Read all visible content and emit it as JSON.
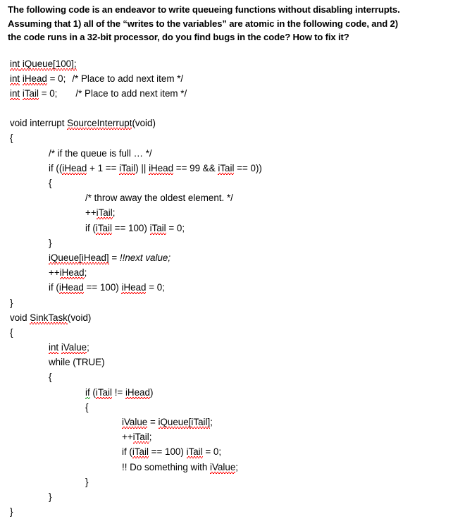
{
  "document": {
    "background_color": "#ffffff",
    "text_color": "#000000",
    "spellcheck_underline_color": "#ff0000",
    "grammarcheck_underline_color": "#2ca02c"
  },
  "prompt": {
    "line1": "The following code is an endeavor to write queueing functions without disabling interrupts.",
    "line2": "Assuming that 1) all of the “writes to the variables” are atomic in the following code, and 2)",
    "line3": "the code runs in a 32-bit processor, do you find bugs in the code? How to fix it?"
  },
  "code": {
    "declarations": {
      "queue_decl_kw": "int",
      "queue_decl_rest": " iQueue[100];",
      "head_decl_kw": "int",
      "head_decl_name": "iHead",
      "head_decl_rest": " = 0;",
      "head_decl_comment": "/* Place to add next item */",
      "tail_decl_kw": "int",
      "tail_decl_name": "iTail",
      "tail_decl_rest": " = 0;",
      "tail_decl_comment": "/* Place to add next item */"
    },
    "source_interrupt": {
      "signature_prefix": "void interrupt ",
      "signature_name": "SourceInterrupt",
      "signature_suffix": "(void)",
      "open_brace": "{",
      "comment_full": "/* if the queue is full … */",
      "if_full_a": "if ((",
      "if_full_head1": "iHead",
      "if_full_b": " + 1 == ",
      "if_full_tail1": "iTail",
      "if_full_c": ") || ",
      "if_full_head2": "iHead",
      "if_full_d": " == 99 && ",
      "if_full_tail2": "iTail",
      "if_full_e": " == 0))",
      "inner_open_brace": "{",
      "comment_throw": "/* throw away the oldest element. */",
      "inc_tail_prefix": "++",
      "inc_tail_name": "iTail",
      "inc_tail_suffix": ";",
      "wrap_tail_a": "if (",
      "wrap_tail_name1": "iTail",
      "wrap_tail_b": " == 100) ",
      "wrap_tail_name2": "iTail",
      "wrap_tail_c": " = 0;",
      "inner_close_brace": "}",
      "store_name": "iQueue[iHead]",
      "store_mid": " = ",
      "store_value": "!!next value;",
      "inc_head_prefix": "++",
      "inc_head_name": "iHead",
      "inc_head_suffix": ";",
      "wrap_head_a": "if (",
      "wrap_head_name1": "iHead",
      "wrap_head_b": " == 100) ",
      "wrap_head_name2": "iHead",
      "wrap_head_c": " = 0;",
      "close_brace": "}"
    },
    "sink_task": {
      "signature_prefix": "void ",
      "signature_name": "SinkTask",
      "signature_suffix": "(void)",
      "open_brace": "{",
      "value_decl_kw": "int",
      "value_decl_name": "iValue",
      "value_decl_suffix": ";",
      "while_line": "while (TRUE)",
      "while_open_brace": "{",
      "if_kw": "if",
      "if_a": " (",
      "if_tail": "iTail",
      "if_b": " != ",
      "if_head": "iHead",
      "if_c": ")",
      "if_open_brace": "{",
      "read_name": "iValue",
      "read_mid": " = ",
      "read_src": "iQueue[iTail]",
      "read_suffix": ";",
      "inc_tail_prefix": "++",
      "inc_tail_name": "iTail",
      "inc_tail_suffix": ";",
      "wrap_tail_a": "if (",
      "wrap_tail_name1": "iTail",
      "wrap_tail_b": " == 100) ",
      "wrap_tail_name2": "iTail",
      "wrap_tail_c": " = 0;",
      "do_something_prefix": "!! Do something with ",
      "do_something_name": "iValue",
      "do_something_suffix": ";",
      "if_close_brace": "}",
      "while_close_brace": "}",
      "close_brace": "}"
    }
  }
}
